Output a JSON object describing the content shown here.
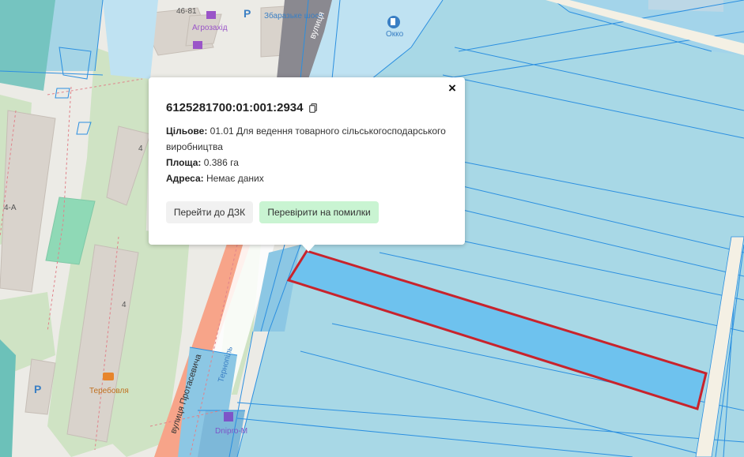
{
  "map": {
    "labels": {
      "house_46_81": "46-81",
      "agrozahid": "Агрозахід",
      "zbarazke_shose": "Збаразьке шосе",
      "vulytsia_top": "вулиця",
      "okko": "Окко",
      "house_4_top": "4",
      "house_4a": "4-А",
      "house_4_mid": "4",
      "terebovlia": "Теребовля",
      "protasevycha": "вулиця Протасевича",
      "ternopil": "Тернопіль",
      "dnipro": "Dnipro-М",
      "parking_top": "P",
      "parking_bottom": "P"
    },
    "colors": {
      "parcel_highlight_fill": "#6ec2ee",
      "parcel_highlight_stroke": "#c8232c",
      "parcel_fill": "#a8d8e6",
      "parcel_line": "#2b8fe0",
      "road_main": "#f7a489"
    }
  },
  "popup": {
    "cadastral_number": "6125281700:01:001:2934",
    "close_label": "×",
    "purpose_label": "Цільове:",
    "purpose_value": "01.01 Для ведення товарного сільськогосподарського виробництва",
    "area_label": "Площа:",
    "area_value": "0.386 га",
    "address_label": "Адреса:",
    "address_value": "Немає даних",
    "button_dzk": "Перейти до ДЗК",
    "button_check": "Перевірити на помилки",
    "icons": {
      "copy": "copy-icon",
      "close": "close-icon"
    }
  }
}
